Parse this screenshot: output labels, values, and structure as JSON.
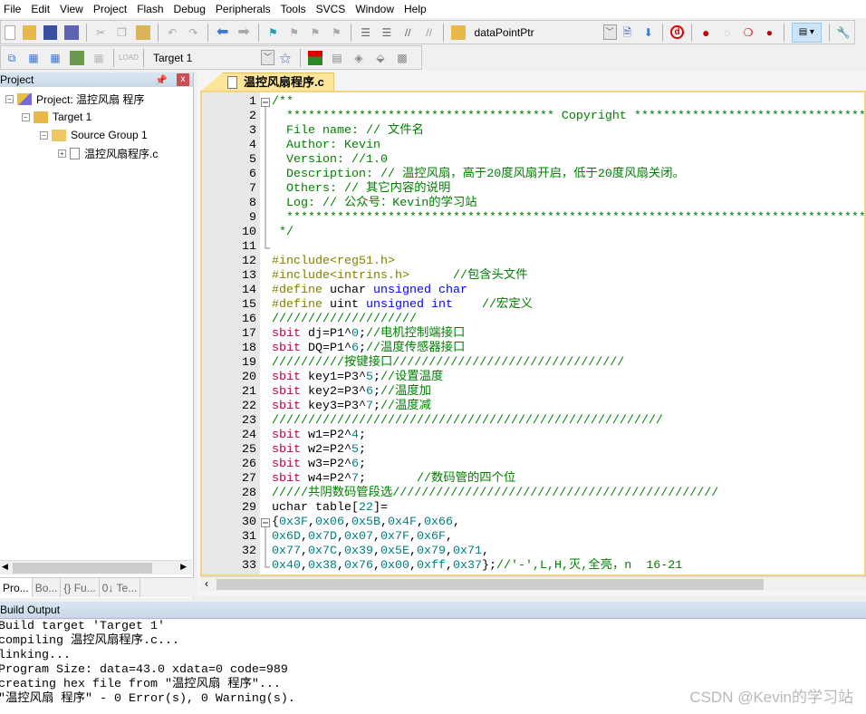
{
  "menu": [
    "File",
    "Edit",
    "View",
    "Project",
    "Flash",
    "Debug",
    "Peripherals",
    "Tools",
    "SVCS",
    "Window",
    "Help"
  ],
  "toolbar": {
    "find_combo_value": "dataPointPtr",
    "target_combo_value": "Target 1"
  },
  "project_panel": {
    "title": "Project",
    "tree": [
      {
        "label": "Project: 温控风扇 程序",
        "icon": "project-icon",
        "expander": "−"
      },
      {
        "label": "Target 1",
        "icon": "target-folder-icon",
        "expander": "−"
      },
      {
        "label": "Source Group 1",
        "icon": "folder-icon",
        "expander": "−"
      },
      {
        "label": "温控风扇程序.c",
        "icon": "file-icon",
        "expander": "+"
      }
    ],
    "tabs": [
      "Pro...",
      "Bo...",
      "{} Fu...",
      "0↓ Te..."
    ]
  },
  "editor": {
    "tab_label": "温控风扇程序.c",
    "lines": [
      "/**",
      "  ************************************* Copyright *****************************************",
      "  File name: // 文件名",
      "  Author: Kevin",
      "  Version: //1.0",
      "  Description: // 温控风扇，高于20度风扇开启，低于20度风扇关闭。",
      "  Others: // 其它内容的说明",
      "  Log: // 公众号：Kevin的学习站",
      "  *****************************************************************************************",
      " */",
      "",
      "#include<reg51.h>",
      "#include<intrins.h>      //包含头文件",
      "#define uchar unsigned char",
      "#define uint unsigned int    //宏定义",
      "////////////////////",
      "sbit dj=P1^0;//电机控制端接口",
      "sbit DQ=P1^6;//温度传感器接口",
      "//////////按键接口////////////////////////////////",
      "sbit key1=P3^5;//设置温度",
      "sbit key2=P3^6;//温度加",
      "sbit key3=P3^7;//温度减",
      "//////////////////////////////////////////////////////",
      "sbit w1=P2^4;",
      "sbit w2=P2^5;",
      "sbit w3=P2^6;",
      "sbit w4=P2^7;       //数码管的四个位",
      "/////共阴数码管段选/////////////////////////////////////////////",
      "uchar table[22]=",
      "{0x3F,0x06,0x5B,0x4F,0x66,",
      "0x6D,0x7D,0x07,0x7F,0x6F,",
      "0x77,0x7C,0x39,0x5E,0x79,0x71,",
      "0x40,0x38,0x76,0x00,0xff,0x37};//'-',L,H,灭,全亮，n  16-21"
    ]
  },
  "build_output": {
    "title": "Build Output",
    "lines": [
      "Build target 'Target 1'",
      "compiling 温控风扇程序.c...",
      "linking...",
      "Program Size: data=43.0 xdata=0 code=989",
      "creating hex file from \"温控风扇 程序\"...",
      "\"温控风扇 程序\" - 0 Error(s), 0 Warning(s)."
    ]
  },
  "watermark": "CSDN @Kevin的学习站",
  "colors": {
    "comment": "#008000",
    "preprocessor": "#808000",
    "keyword": "#0000ff",
    "sbit": "#c0003c",
    "number": "#008080",
    "tab_active": "#fde59a"
  }
}
